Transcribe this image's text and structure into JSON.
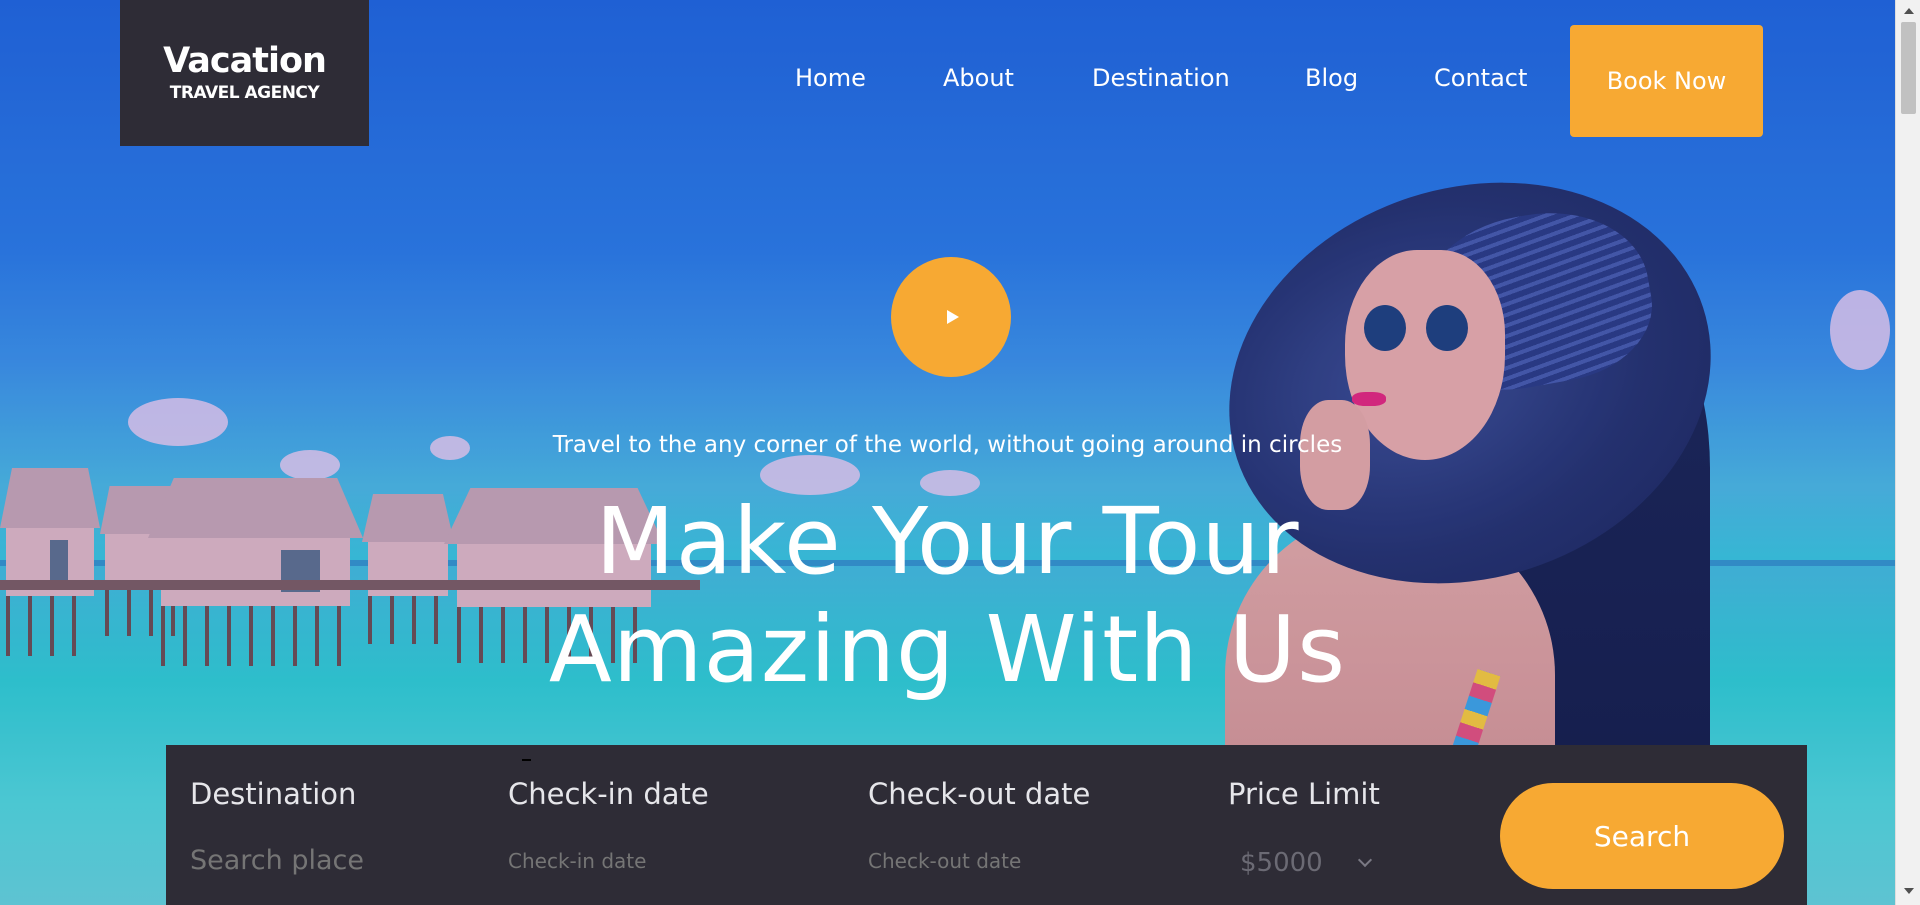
{
  "header": {
    "logo_title": "Vacation",
    "logo_subtitle": "TRAVEL AGENCY",
    "nav": [
      "Home",
      "About",
      "Destination",
      "Blog",
      "Contact"
    ],
    "cta_label": "Book Now"
  },
  "hero": {
    "tagline": "Travel to the any corner of the world, without going around in circles",
    "headline_line1": "Make Your Tour",
    "headline_line2": "Amazing With Us"
  },
  "search": {
    "destination_label": "Destination",
    "destination_placeholder": "Search place",
    "checkin_label": "Check-in date",
    "checkin_placeholder": "Check-in date",
    "checkout_label": "Check-out date",
    "checkout_placeholder": "Check-out date",
    "price_label": "Price Limit",
    "price_value": "$5000",
    "button_label": "Search"
  },
  "colors": {
    "accent": "#f7a933",
    "dark_panel": "#2e2c36",
    "hero_blue": "#1f63d8"
  }
}
